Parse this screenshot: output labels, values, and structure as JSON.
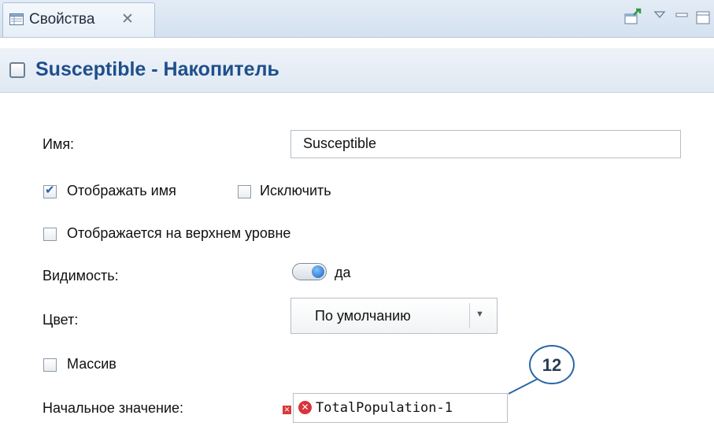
{
  "tab": {
    "label": "Свойства",
    "close": "✕"
  },
  "header": {
    "title": "Susceptible - Накопитель"
  },
  "form": {
    "name_label": "Имя:",
    "name_value": "Susceptible",
    "show_name_label": "Отображать имя",
    "show_name_checked": true,
    "exclude_label": "Исключить",
    "exclude_checked": false,
    "top_level_label": "Отображается на верхнем уровне",
    "top_level_checked": false,
    "visibility_label": "Видимость:",
    "visibility_value": "да",
    "color_label": "Цвет:",
    "color_value": "По умолчанию",
    "array_label": "Массив",
    "array_checked": false,
    "initial_label": "Начальное значение:",
    "initial_value": "TotalPopulation-1"
  },
  "callout": {
    "number": "12"
  },
  "icons": {
    "tab": "properties-table-icon",
    "pin": "pin-icon",
    "menu": "view-menu-icon",
    "minimize": "minimize-icon",
    "maximize": "maximize-icon",
    "error": "error-icon"
  },
  "colors": {
    "header_title": "#1f4f8b",
    "accent": "#2a67a8",
    "error": "#d9343a"
  }
}
